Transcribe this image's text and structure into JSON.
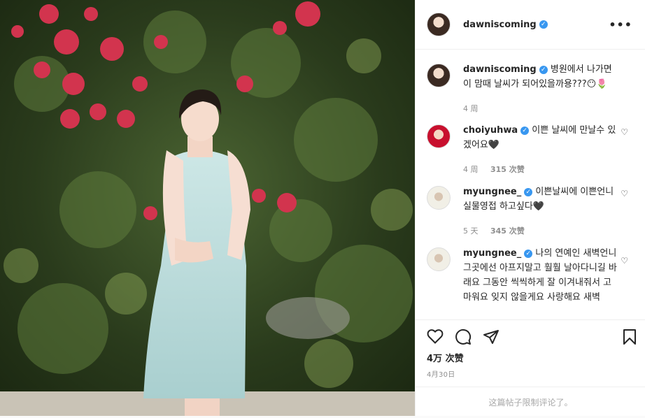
{
  "post": {
    "author": "dawniscoming",
    "verified_mark": "✓",
    "more_icon": "•••",
    "caption": {
      "username": "dawniscoming",
      "text": "병원에서 나가면 이 맘때 날씨가 되어있을까용???😶🌷",
      "time": "4 周"
    },
    "comments": [
      {
        "username": "choiyuhwa",
        "text": "이쁜 날씨에 만날수 있겠어요🖤",
        "time": "4 周",
        "likes": "315 次赞"
      },
      {
        "username": "myungnee_",
        "text": "이쁜날씨에 이쁜언니 실물영접 하고싶다🖤",
        "time": "5 天",
        "likes": "345 次赞"
      },
      {
        "username": "myungnee_",
        "text": "나의 연예인 새벽언니 그곳에선 아프지말고 훨훨 날아다니길 바래요 그동안 씩씩하게 잘 이겨내줘서 고마워요 잊지 않을게요 사랑해요 새벽"
      }
    ],
    "likes_total": "4万 次赞",
    "date": "4月30日",
    "comments_restricted": "这篇帖子限制评论了。"
  },
  "icons": {
    "like": "heart-icon",
    "comment": "comment-icon",
    "share": "send-icon",
    "save": "bookmark-icon",
    "comment_like": "heart-outline-icon"
  },
  "colors": {
    "verified": "#3897f0",
    "muted": "#8e8e8e",
    "text": "#262626"
  }
}
